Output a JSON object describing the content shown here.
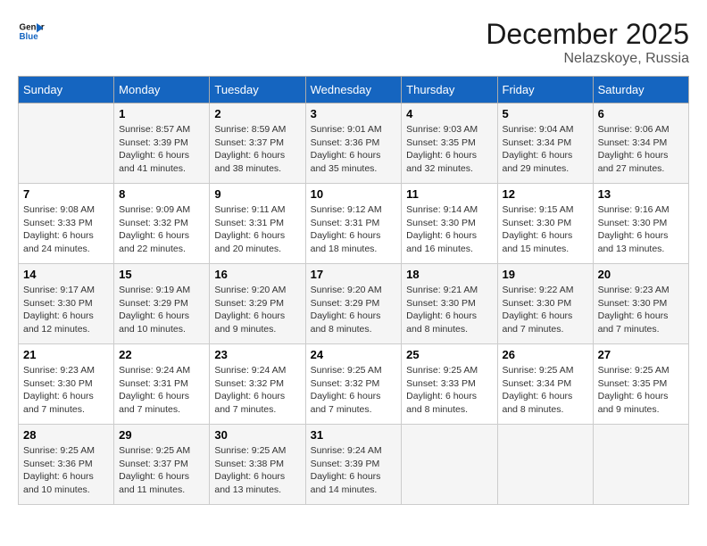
{
  "header": {
    "logo_line1": "General",
    "logo_line2": "Blue",
    "month_title": "December 2025",
    "location": "Nelazskoye, Russia"
  },
  "weekdays": [
    "Sunday",
    "Monday",
    "Tuesday",
    "Wednesday",
    "Thursday",
    "Friday",
    "Saturday"
  ],
  "weeks": [
    [
      {
        "day": "",
        "info": ""
      },
      {
        "day": "1",
        "info": "Sunrise: 8:57 AM\nSunset: 3:39 PM\nDaylight: 6 hours\nand 41 minutes."
      },
      {
        "day": "2",
        "info": "Sunrise: 8:59 AM\nSunset: 3:37 PM\nDaylight: 6 hours\nand 38 minutes."
      },
      {
        "day": "3",
        "info": "Sunrise: 9:01 AM\nSunset: 3:36 PM\nDaylight: 6 hours\nand 35 minutes."
      },
      {
        "day": "4",
        "info": "Sunrise: 9:03 AM\nSunset: 3:35 PM\nDaylight: 6 hours\nand 32 minutes."
      },
      {
        "day": "5",
        "info": "Sunrise: 9:04 AM\nSunset: 3:34 PM\nDaylight: 6 hours\nand 29 minutes."
      },
      {
        "day": "6",
        "info": "Sunrise: 9:06 AM\nSunset: 3:34 PM\nDaylight: 6 hours\nand 27 minutes."
      }
    ],
    [
      {
        "day": "7",
        "info": "Sunrise: 9:08 AM\nSunset: 3:33 PM\nDaylight: 6 hours\nand 24 minutes."
      },
      {
        "day": "8",
        "info": "Sunrise: 9:09 AM\nSunset: 3:32 PM\nDaylight: 6 hours\nand 22 minutes."
      },
      {
        "day": "9",
        "info": "Sunrise: 9:11 AM\nSunset: 3:31 PM\nDaylight: 6 hours\nand 20 minutes."
      },
      {
        "day": "10",
        "info": "Sunrise: 9:12 AM\nSunset: 3:31 PM\nDaylight: 6 hours\nand 18 minutes."
      },
      {
        "day": "11",
        "info": "Sunrise: 9:14 AM\nSunset: 3:30 PM\nDaylight: 6 hours\nand 16 minutes."
      },
      {
        "day": "12",
        "info": "Sunrise: 9:15 AM\nSunset: 3:30 PM\nDaylight: 6 hours\nand 15 minutes."
      },
      {
        "day": "13",
        "info": "Sunrise: 9:16 AM\nSunset: 3:30 PM\nDaylight: 6 hours\nand 13 minutes."
      }
    ],
    [
      {
        "day": "14",
        "info": "Sunrise: 9:17 AM\nSunset: 3:30 PM\nDaylight: 6 hours\nand 12 minutes."
      },
      {
        "day": "15",
        "info": "Sunrise: 9:19 AM\nSunset: 3:29 PM\nDaylight: 6 hours\nand 10 minutes."
      },
      {
        "day": "16",
        "info": "Sunrise: 9:20 AM\nSunset: 3:29 PM\nDaylight: 6 hours\nand 9 minutes."
      },
      {
        "day": "17",
        "info": "Sunrise: 9:20 AM\nSunset: 3:29 PM\nDaylight: 6 hours\nand 8 minutes."
      },
      {
        "day": "18",
        "info": "Sunrise: 9:21 AM\nSunset: 3:30 PM\nDaylight: 6 hours\nand 8 minutes."
      },
      {
        "day": "19",
        "info": "Sunrise: 9:22 AM\nSunset: 3:30 PM\nDaylight: 6 hours\nand 7 minutes."
      },
      {
        "day": "20",
        "info": "Sunrise: 9:23 AM\nSunset: 3:30 PM\nDaylight: 6 hours\nand 7 minutes."
      }
    ],
    [
      {
        "day": "21",
        "info": "Sunrise: 9:23 AM\nSunset: 3:30 PM\nDaylight: 6 hours\nand 7 minutes."
      },
      {
        "day": "22",
        "info": "Sunrise: 9:24 AM\nSunset: 3:31 PM\nDaylight: 6 hours\nand 7 minutes."
      },
      {
        "day": "23",
        "info": "Sunrise: 9:24 AM\nSunset: 3:32 PM\nDaylight: 6 hours\nand 7 minutes."
      },
      {
        "day": "24",
        "info": "Sunrise: 9:25 AM\nSunset: 3:32 PM\nDaylight: 6 hours\nand 7 minutes."
      },
      {
        "day": "25",
        "info": "Sunrise: 9:25 AM\nSunset: 3:33 PM\nDaylight: 6 hours\nand 8 minutes."
      },
      {
        "day": "26",
        "info": "Sunrise: 9:25 AM\nSunset: 3:34 PM\nDaylight: 6 hours\nand 8 minutes."
      },
      {
        "day": "27",
        "info": "Sunrise: 9:25 AM\nSunset: 3:35 PM\nDaylight: 6 hours\nand 9 minutes."
      }
    ],
    [
      {
        "day": "28",
        "info": "Sunrise: 9:25 AM\nSunset: 3:36 PM\nDaylight: 6 hours\nand 10 minutes."
      },
      {
        "day": "29",
        "info": "Sunrise: 9:25 AM\nSunset: 3:37 PM\nDaylight: 6 hours\nand 11 minutes."
      },
      {
        "day": "30",
        "info": "Sunrise: 9:25 AM\nSunset: 3:38 PM\nDaylight: 6 hours\nand 13 minutes."
      },
      {
        "day": "31",
        "info": "Sunrise: 9:24 AM\nSunset: 3:39 PM\nDaylight: 6 hours\nand 14 minutes."
      },
      {
        "day": "",
        "info": ""
      },
      {
        "day": "",
        "info": ""
      },
      {
        "day": "",
        "info": ""
      }
    ]
  ]
}
